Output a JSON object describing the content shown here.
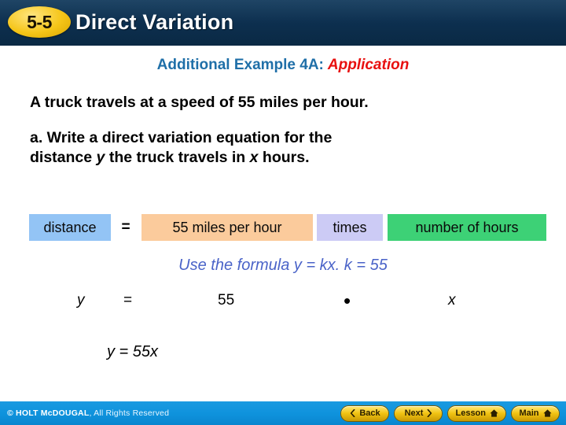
{
  "header": {
    "lesson_number": "5-5",
    "title": "Direct Variation",
    "bg_color": "#0d3050",
    "badge_color": "#f5c518"
  },
  "content": {
    "example_heading": "Additional Example 4A:",
    "example_heading_accent": "Application",
    "heading_color": "#1f6fa8",
    "accent_color": "#e8100f",
    "problem_statement": "A truck travels at a speed of 55 miles per hour.",
    "question_part_a": {
      "prefix": "a. Write a direct variation equation for the",
      "line2_pre": "distance ",
      "line2_var1": "y",
      "line2_mid": " the truck travels in ",
      "line2_var2": "x",
      "line2_post": " hours."
    },
    "word_equation": {
      "distance_label": "distance",
      "equals_symbol": "=",
      "rate_label": "55 miles per hour",
      "times_label": "times",
      "hours_label": "number of hours",
      "distance_color": "#93c4f5",
      "rate_color": "#fbcb9c",
      "times_color": "#cccbf5",
      "hours_color": "#3dd176"
    },
    "formula_hint": "Use the formula y = kx. k = 55",
    "formula_hint_color": "#4a63c8",
    "equation_row": {
      "y": "y",
      "equals": "=",
      "k_value": "55",
      "multiply": "•",
      "x": "x"
    },
    "final_answer": "y = 55x"
  },
  "footer": {
    "copyright_brand": "© HOLT McDOUGAL",
    "copyright_rest": ", All Rights Reserved",
    "bg_color": "#0f93dd",
    "buttons": [
      {
        "label": "Back",
        "icon": "chevron-left-icon"
      },
      {
        "label": "Next",
        "icon": "chevron-right-icon"
      },
      {
        "label": "Lesson",
        "icon": "home-icon"
      },
      {
        "label": "Main",
        "icon": "home-icon"
      }
    ]
  }
}
